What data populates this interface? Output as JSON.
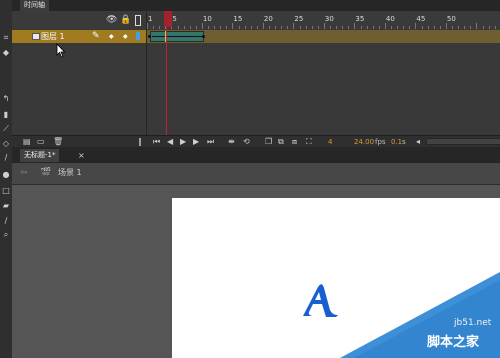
{
  "timeline": {
    "tab_label": "时间轴",
    "header_icons": [
      "eye-icon",
      "lock-icon",
      "outline-icon"
    ],
    "frame_ticks": [
      "1",
      "5",
      "10",
      "15",
      "20",
      "25",
      "30",
      "35",
      "40",
      "45",
      "50"
    ],
    "layer": {
      "name": "图层 1"
    },
    "footer": {
      "current_frame": "4",
      "fps": "24.00",
      "fps_unit": "fps",
      "time": "0.1",
      "time_unit": "s"
    }
  },
  "document": {
    "tab_label": "无标题-1*",
    "tab_close": "×",
    "scene_label": "场景 1"
  },
  "stage": {
    "glyph": "A",
    "glyph_color": "#1a5fd0"
  },
  "watermark": {
    "url": "jb51.net",
    "text": "脚本之家",
    "color": "#3d8fd8"
  },
  "colors": {
    "layer_highlight": "#a07b20",
    "tween": "#35766a",
    "playhead": "#c0232d"
  }
}
